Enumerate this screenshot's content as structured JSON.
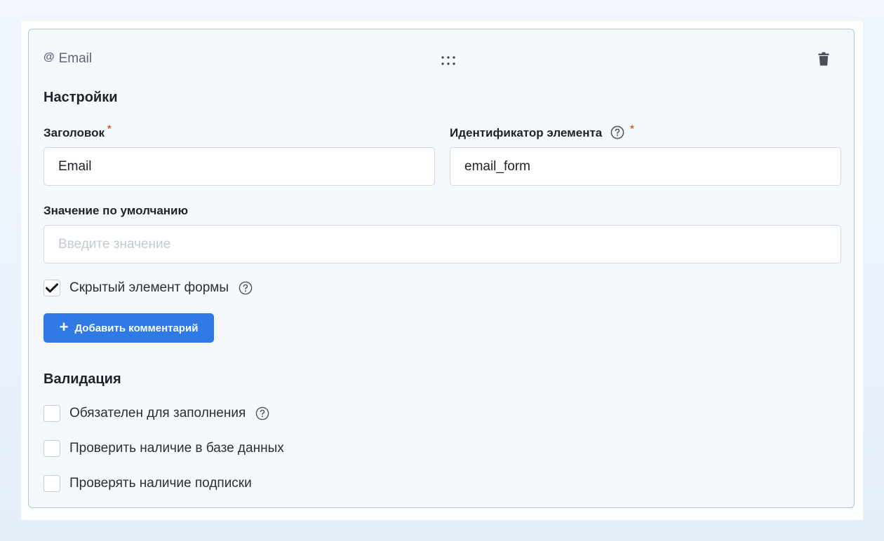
{
  "header": {
    "type_icon": "@",
    "type_label": "Email",
    "drag_icon": "drag-dots-icon",
    "delete_icon": "trash-icon"
  },
  "settings": {
    "title": "Настройки",
    "title_field": {
      "label": "Заголовок",
      "required_mark": "*",
      "value": "Email"
    },
    "id_field": {
      "label": "Идентификатор элемента",
      "required_mark": "*",
      "value": "email_form"
    },
    "default_field": {
      "label": "Значение по умолчанию",
      "value": "",
      "placeholder": "Введите значение"
    },
    "hidden_checkbox": {
      "label": "Скрытый элемент формы",
      "checked": true
    },
    "add_comment_button": {
      "icon": "+",
      "label": "Добавить комментарий"
    }
  },
  "validation": {
    "title": "Валидация",
    "options": [
      {
        "label": "Обязателен для заполнения",
        "checked": false,
        "help": true
      },
      {
        "label": "Проверить наличие в базе данных",
        "checked": false,
        "help": false
      },
      {
        "label": "Проверять наличие подписки",
        "checked": false,
        "help": false
      }
    ]
  },
  "colors": {
    "accent": "#2f7ae5",
    "card_border": "#a9c8ee",
    "required": "#d25a1f"
  }
}
